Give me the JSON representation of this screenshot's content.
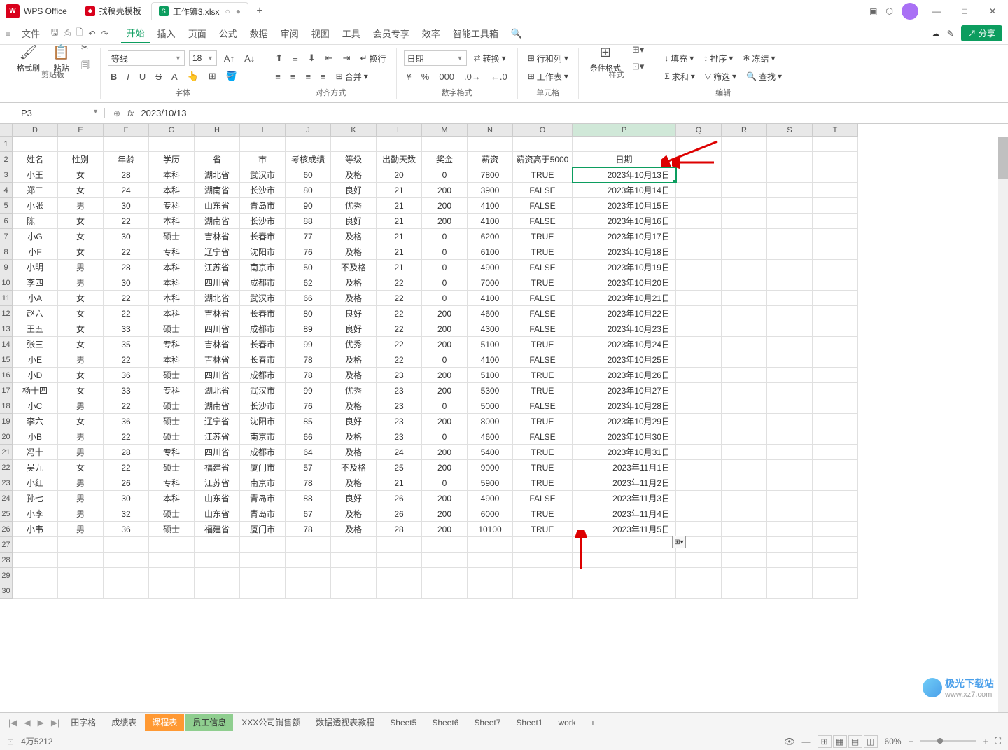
{
  "app": {
    "name": "WPS Office"
  },
  "tabs": [
    {
      "label": "找稿壳模板",
      "iconColor": "red"
    },
    {
      "label": "工作簿3.xlsx",
      "iconColor": "green",
      "active": true
    }
  ],
  "menubar": {
    "file": "文件",
    "items": [
      "开始",
      "插入",
      "页面",
      "公式",
      "数据",
      "审阅",
      "视图",
      "工具",
      "会员专享",
      "效率",
      "智能工具箱"
    ],
    "share": "分享"
  },
  "ribbon": {
    "clipboard": {
      "format_painter": "格式刷",
      "paste": "粘贴",
      "label": "剪贴板"
    },
    "font": {
      "name": "等线",
      "size": "18",
      "label": "字体"
    },
    "align": {
      "wrap": "换行",
      "merge": "合并",
      "label": "对齐方式"
    },
    "number": {
      "format": "日期",
      "convert": "转换",
      "label": "数字格式"
    },
    "cells": {
      "rowcol": "行和列",
      "worksheet": "工作表",
      "label": "单元格"
    },
    "styles": {
      "cond": "条件格式",
      "label": "样式"
    },
    "editing": {
      "fill": "填充",
      "sort": "排序",
      "freeze": "冻结",
      "sum": "求和",
      "filter": "筛选",
      "find": "查找",
      "label": "编辑"
    }
  },
  "formula_bar": {
    "cell_ref": "P3",
    "formula": "2023/10/13"
  },
  "columns": [
    "",
    "D",
    "E",
    "F",
    "G",
    "H",
    "I",
    "J",
    "K",
    "L",
    "M",
    "N",
    "O",
    "P",
    "Q",
    "R",
    "S",
    "T"
  ],
  "headers": [
    "姓名",
    "性别",
    "年龄",
    "学历",
    "省",
    "市",
    "考核成绩",
    "等级",
    "出勤天数",
    "奖金",
    "薪资",
    "薪资高于5000",
    "日期"
  ],
  "rows": [
    [
      "小王",
      "女",
      "28",
      "本科",
      "湖北省",
      "武汉市",
      "60",
      "及格",
      "20",
      "0",
      "7800",
      "TRUE",
      "2023年10月13日"
    ],
    [
      "郑二",
      "女",
      "24",
      "本科",
      "湖南省",
      "长沙市",
      "80",
      "良好",
      "21",
      "200",
      "3900",
      "FALSE",
      "2023年10月14日"
    ],
    [
      "小张",
      "男",
      "30",
      "专科",
      "山东省",
      "青岛市",
      "90",
      "优秀",
      "21",
      "200",
      "4100",
      "FALSE",
      "2023年10月15日"
    ],
    [
      "陈一",
      "女",
      "22",
      "本科",
      "湖南省",
      "长沙市",
      "88",
      "良好",
      "21",
      "200",
      "4100",
      "FALSE",
      "2023年10月16日"
    ],
    [
      "小G",
      "女",
      "30",
      "硕士",
      "吉林省",
      "长春市",
      "77",
      "及格",
      "21",
      "0",
      "6200",
      "TRUE",
      "2023年10月17日"
    ],
    [
      "小F",
      "女",
      "22",
      "专科",
      "辽宁省",
      "沈阳市",
      "76",
      "及格",
      "21",
      "0",
      "6100",
      "TRUE",
      "2023年10月18日"
    ],
    [
      "小明",
      "男",
      "28",
      "本科",
      "江苏省",
      "南京市",
      "50",
      "不及格",
      "21",
      "0",
      "4900",
      "FALSE",
      "2023年10月19日"
    ],
    [
      "李四",
      "男",
      "30",
      "本科",
      "四川省",
      "成都市",
      "62",
      "及格",
      "22",
      "0",
      "7000",
      "TRUE",
      "2023年10月20日"
    ],
    [
      "小A",
      "女",
      "22",
      "本科",
      "湖北省",
      "武汉市",
      "66",
      "及格",
      "22",
      "0",
      "4100",
      "FALSE",
      "2023年10月21日"
    ],
    [
      "赵六",
      "女",
      "22",
      "本科",
      "吉林省",
      "长春市",
      "80",
      "良好",
      "22",
      "200",
      "4600",
      "FALSE",
      "2023年10月22日"
    ],
    [
      "王五",
      "女",
      "33",
      "硕士",
      "四川省",
      "成都市",
      "89",
      "良好",
      "22",
      "200",
      "4300",
      "FALSE",
      "2023年10月23日"
    ],
    [
      "张三",
      "女",
      "35",
      "专科",
      "吉林省",
      "长春市",
      "99",
      "优秀",
      "22",
      "200",
      "5100",
      "TRUE",
      "2023年10月24日"
    ],
    [
      "小E",
      "男",
      "22",
      "本科",
      "吉林省",
      "长春市",
      "78",
      "及格",
      "22",
      "0",
      "4100",
      "FALSE",
      "2023年10月25日"
    ],
    [
      "小D",
      "女",
      "36",
      "硕士",
      "四川省",
      "成都市",
      "78",
      "及格",
      "23",
      "200",
      "5100",
      "TRUE",
      "2023年10月26日"
    ],
    [
      "杨十四",
      "女",
      "33",
      "专科",
      "湖北省",
      "武汉市",
      "99",
      "优秀",
      "23",
      "200",
      "5300",
      "TRUE",
      "2023年10月27日"
    ],
    [
      "小C",
      "男",
      "22",
      "硕士",
      "湖南省",
      "长沙市",
      "76",
      "及格",
      "23",
      "0",
      "5000",
      "FALSE",
      "2023年10月28日"
    ],
    [
      "李六",
      "女",
      "36",
      "硕士",
      "辽宁省",
      "沈阳市",
      "85",
      "良好",
      "23",
      "200",
      "8000",
      "TRUE",
      "2023年10月29日"
    ],
    [
      "小B",
      "男",
      "22",
      "硕士",
      "江苏省",
      "南京市",
      "66",
      "及格",
      "23",
      "0",
      "4600",
      "FALSE",
      "2023年10月30日"
    ],
    [
      "冯十",
      "男",
      "28",
      "专科",
      "四川省",
      "成都市",
      "64",
      "及格",
      "24",
      "200",
      "5400",
      "TRUE",
      "2023年10月31日"
    ],
    [
      "吴九",
      "女",
      "22",
      "硕士",
      "福建省",
      "厦门市",
      "57",
      "不及格",
      "25",
      "200",
      "9000",
      "TRUE",
      "2023年11月1日"
    ],
    [
      "小红",
      "男",
      "26",
      "专科",
      "江苏省",
      "南京市",
      "78",
      "及格",
      "21",
      "0",
      "5900",
      "TRUE",
      "2023年11月2日"
    ],
    [
      "孙七",
      "男",
      "30",
      "本科",
      "山东省",
      "青岛市",
      "88",
      "良好",
      "26",
      "200",
      "4900",
      "FALSE",
      "2023年11月3日"
    ],
    [
      "小李",
      "男",
      "32",
      "硕士",
      "山东省",
      "青岛市",
      "67",
      "及格",
      "26",
      "200",
      "6000",
      "TRUE",
      "2023年11月4日"
    ],
    [
      "小韦",
      "男",
      "36",
      "硕士",
      "福建省",
      "厦门市",
      "78",
      "及格",
      "28",
      "200",
      "10100",
      "TRUE",
      "2023年11月5日"
    ]
  ],
  "sheet_tabs": [
    "田字格",
    "成绩表",
    "课程表",
    "员工信息",
    "XXX公司销售额",
    "数据透视表教程",
    "Sheet5",
    "Sheet6",
    "Sheet7",
    "Sheet1",
    "work"
  ],
  "statusbar": {
    "count": "4万5212",
    "zoom": "60%"
  },
  "watermark": {
    "text": "极光下载站",
    "url": "www.xz7.com"
  }
}
